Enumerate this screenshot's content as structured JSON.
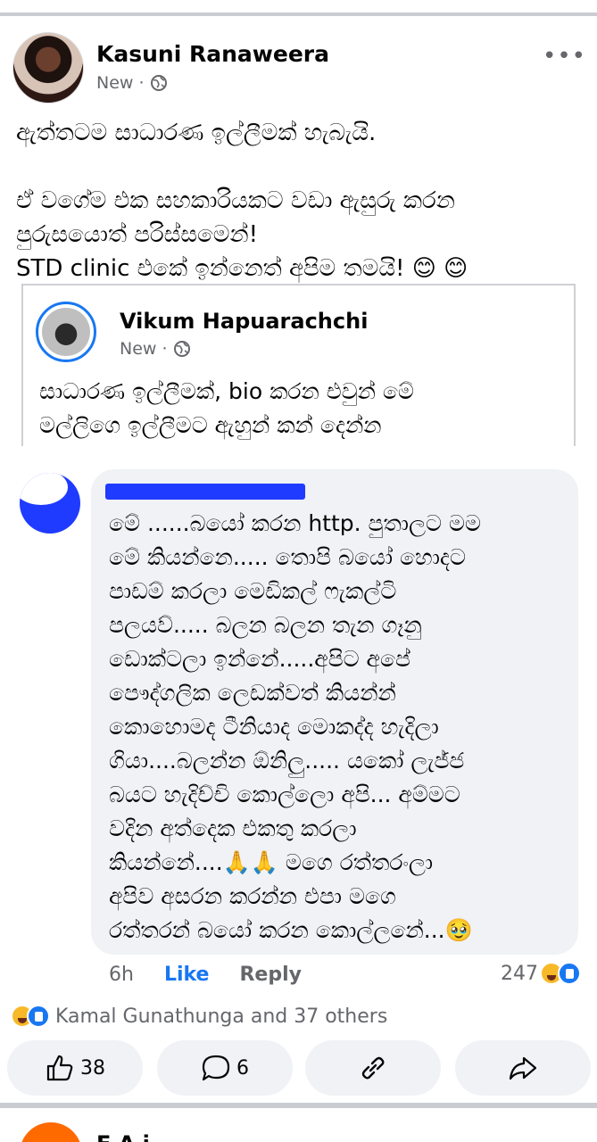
{
  "post": {
    "author": "Kasuni Ranaweera",
    "meta_new": "New",
    "meta_dot": "·",
    "more": "•••",
    "text": "ඇත්තටම සාධාරණ ඉල්ලීමක් හැබැයි.\n\nඒ වගේම එක සහකාරියකට වඩා ඇසුරු කරන\nපුරුසයොත් පරිස්සමෙන්!\nSTD clinic එකේ ඉන්නෙත් අපිම තමයි! 😊 😊"
  },
  "shared_post": {
    "author": "Vikum Hapuarachchi",
    "meta_new": "New",
    "meta_dot": "·",
    "text": "සාධාරණ ඉල්ලීමක්, bio කරන එවුන් මේ\nමල්ලිගෙ ඉල්ලීමට ඇහුන් කන් දෙන්න"
  },
  "comment": {
    "text": "මේ ......බයෝ කරන http. පුතාලට මම\nමේ කියන්නෙ..... තොපි බයෝ හොදට\nපාඩම් කරලා මෙඩිකල් ෆැකල්ටි\nපලයව්..... බලන බලන තැන ගෑනු\nඩොක්ටලා ඉන්නේ.....අපිට අපේ\nපෞද්ගලික  ලෙඩක්වත් කියන්න්\nකොහොමද ටීනියාද මොකද්ද හැදිලා\nගියා....බලන්න ඕනිලු..... යකෝ ලැජ්ජ\nබයට හැදිච්චි කොල්ලො අපි... අම්මට\nවදින අත්දෙක එකතු කරලා\nකියන්නේ....🙏🙏 මගෙ රත්තරංලා\nඅපිව අසරන කරන්න එපා මගෙ\nරත්තරන් බයෝ කරන කොල්ලනේ...🥹",
    "time": "6h",
    "like_label": "Like",
    "reply_label": "Reply",
    "reaction_count": "247"
  },
  "reactions_summary": {
    "text": "Kamal Gunathunga and 37 others"
  },
  "action_bar": {
    "like_count": "38",
    "comment_count": "6"
  },
  "next_post": {
    "author_partial": "E    A  i"
  },
  "colors": {
    "accent": "#1877f2",
    "muted": "#65676b",
    "bubble": "#f0f2f5"
  }
}
